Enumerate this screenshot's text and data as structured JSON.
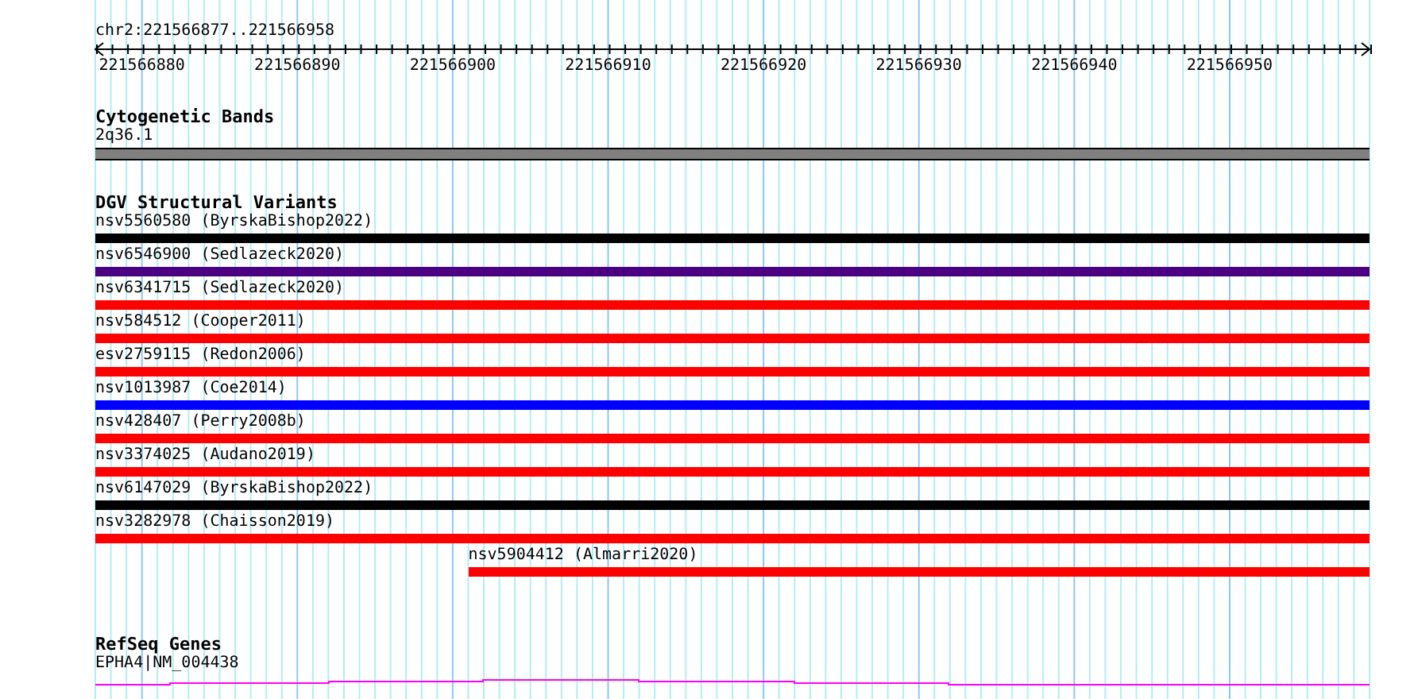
{
  "ruler": {
    "range": "chr2:221566877..221566958",
    "labels": [
      "221566880",
      "221566890",
      "221566900",
      "221566910",
      "221566920",
      "221566930",
      "221566940",
      "221566950"
    ]
  },
  "tracks": [
    {
      "kind": "band",
      "title": "Cytogenetic Bands",
      "features": [
        {
          "label": "2q36.1",
          "color": "#808080"
        }
      ]
    },
    {
      "kind": "variants",
      "title": "DGV Structural Variants",
      "features": [
        {
          "label": "nsv5560580 (ByrskaBishop2022)",
          "color": "#000000"
        },
        {
          "label": "nsv6546900 (Sedlazeck2020)",
          "color": "#4b0082"
        },
        {
          "label": "nsv6341715 (Sedlazeck2020)",
          "color": "#ff0000"
        },
        {
          "label": "nsv584512 (Cooper2011)",
          "color": "#ff0000"
        },
        {
          "label": "esv2759115 (Redon2006)",
          "color": "#ff0000"
        },
        {
          "label": "nsv1013987 (Coe2014)",
          "color": "#0000ff"
        },
        {
          "label": "nsv428407 (Perry2008b)",
          "color": "#ff0000"
        },
        {
          "label": "nsv3374025 (Audano2019)",
          "color": "#ff0000"
        },
        {
          "label": "nsv6147029 (ByrskaBishop2022)",
          "color": "#000000"
        },
        {
          "label": "nsv3282978 (Chaisson2019)",
          "color": "#ff0000"
        },
        {
          "label": "nsv5904412 (Almarri2020)",
          "color": "#ff0000",
          "kind": "partial"
        }
      ]
    },
    {
      "kind": "gene",
      "title": "RefSeq Genes",
      "features": [
        {
          "label": "EPHA4|NM_004438",
          "color": "#ff00ff"
        }
      ]
    }
  ]
}
